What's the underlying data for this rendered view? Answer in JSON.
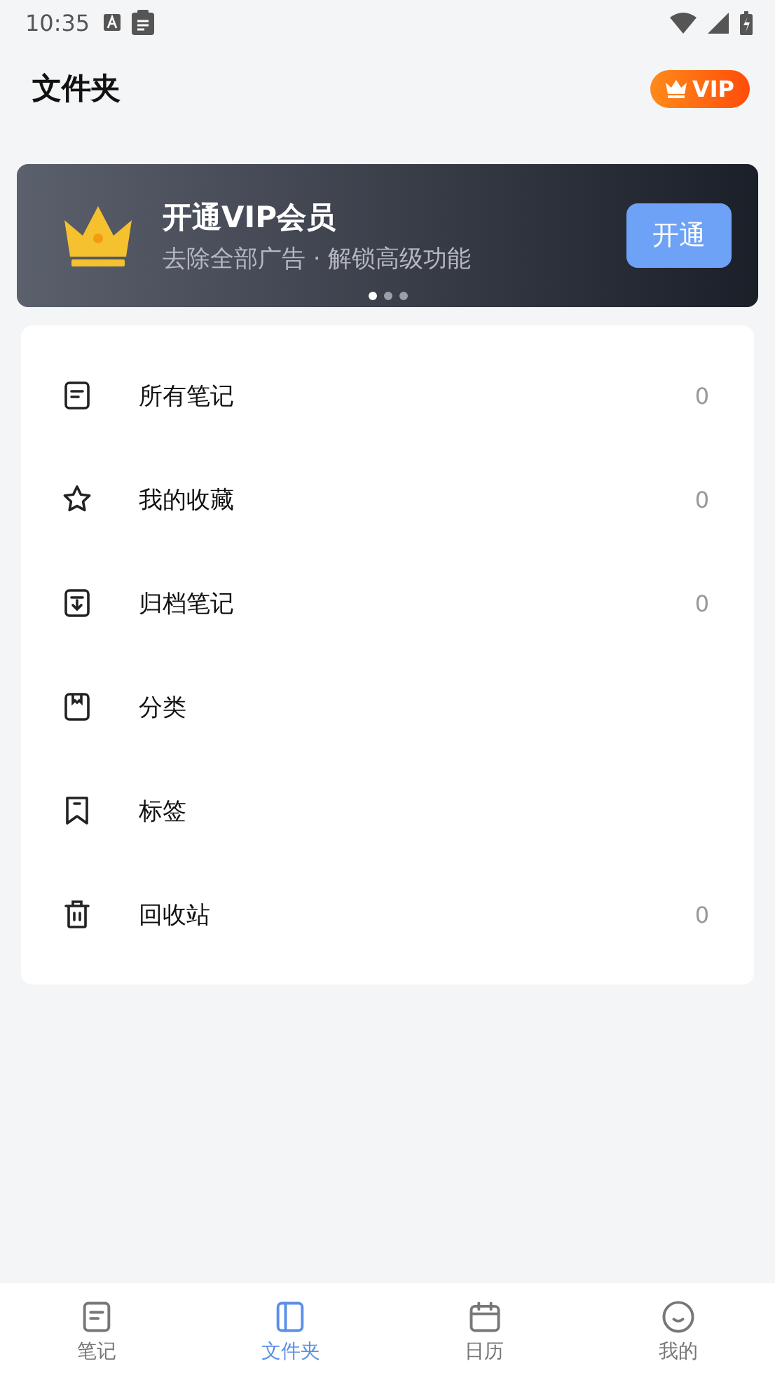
{
  "status_bar": {
    "time": "10:35"
  },
  "header": {
    "title": "文件夹",
    "vip_badge": "VIP"
  },
  "banner": {
    "title": "开通VIP会员",
    "subtitle": "去除全部广告 · 解锁高级功能",
    "button": "开通",
    "dots": [
      {
        "selected": true
      },
      {
        "selected": false
      },
      {
        "selected": false
      }
    ]
  },
  "folders": [
    {
      "kind": "notes",
      "label": "所有笔记",
      "count": "0"
    },
    {
      "kind": "star",
      "label": "我的收藏",
      "count": "0"
    },
    {
      "kind": "archive",
      "label": "归档笔记",
      "count": "0"
    },
    {
      "kind": "category",
      "label": "分类"
    },
    {
      "kind": "tag",
      "label": "标签"
    },
    {
      "kind": "trash",
      "label": "回收站",
      "count": "0"
    }
  ],
  "bottom_nav": [
    {
      "kind": "notes",
      "label": "笔记",
      "selected": false
    },
    {
      "kind": "folder",
      "label": "文件夹",
      "selected": true
    },
    {
      "kind": "calendar",
      "label": "日历",
      "selected": false
    },
    {
      "kind": "me",
      "label": "我的",
      "selected": false
    }
  ]
}
